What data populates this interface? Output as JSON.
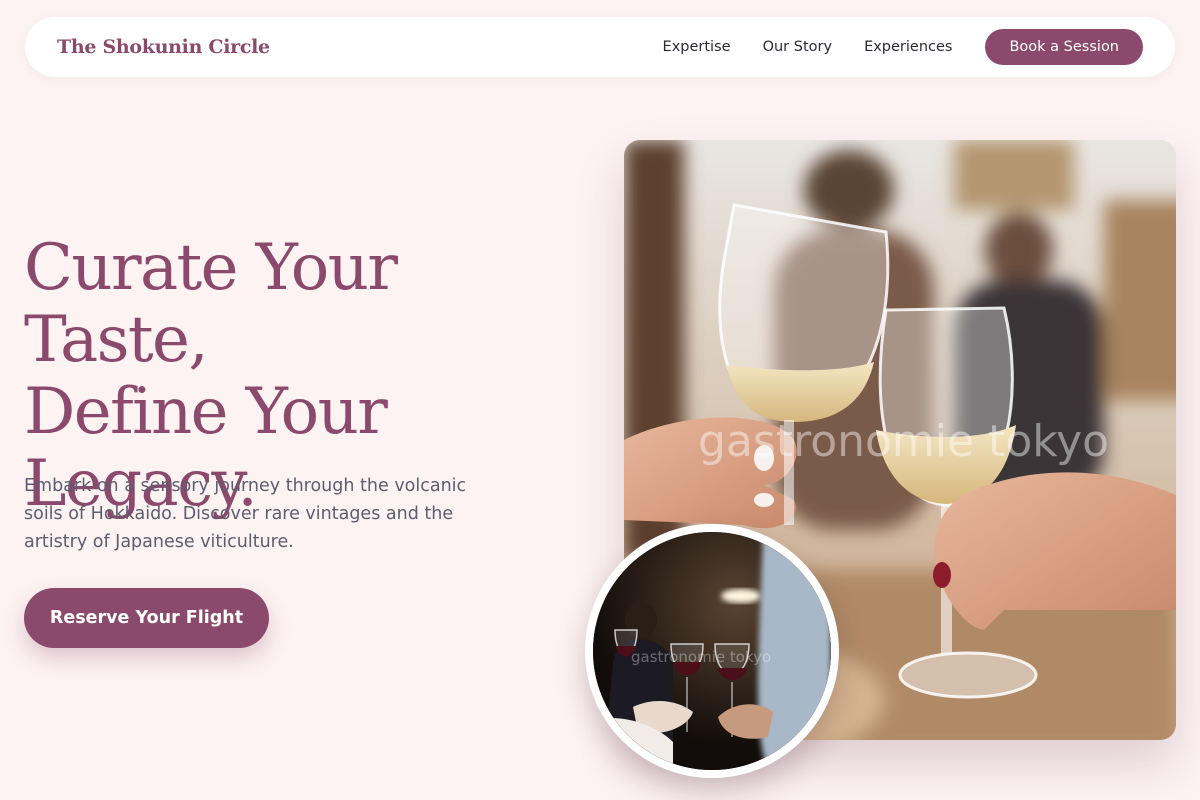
{
  "nav": {
    "logo": "The Shokunin Circle",
    "links": [
      "Expertise",
      "Our Story",
      "Experiences"
    ],
    "cta": "Book a Session"
  },
  "hero": {
    "title_lines": [
      "Curate Your Taste,",
      "Define Your",
      "Legacy."
    ],
    "subtitle": "Embark on a sensory journey through the volcanic soils of Hokkaido. Discover rare vintages and the artistry of Japanese viticulture.",
    "cta": "Reserve Your Flight"
  },
  "images": {
    "main_watermark": "gastronomie tokyo",
    "circle_watermark": "gastronomie tokyo"
  },
  "colors": {
    "brand": "#8b4a6b",
    "background": "#fdf3f3",
    "text": "#5d5d6e"
  }
}
